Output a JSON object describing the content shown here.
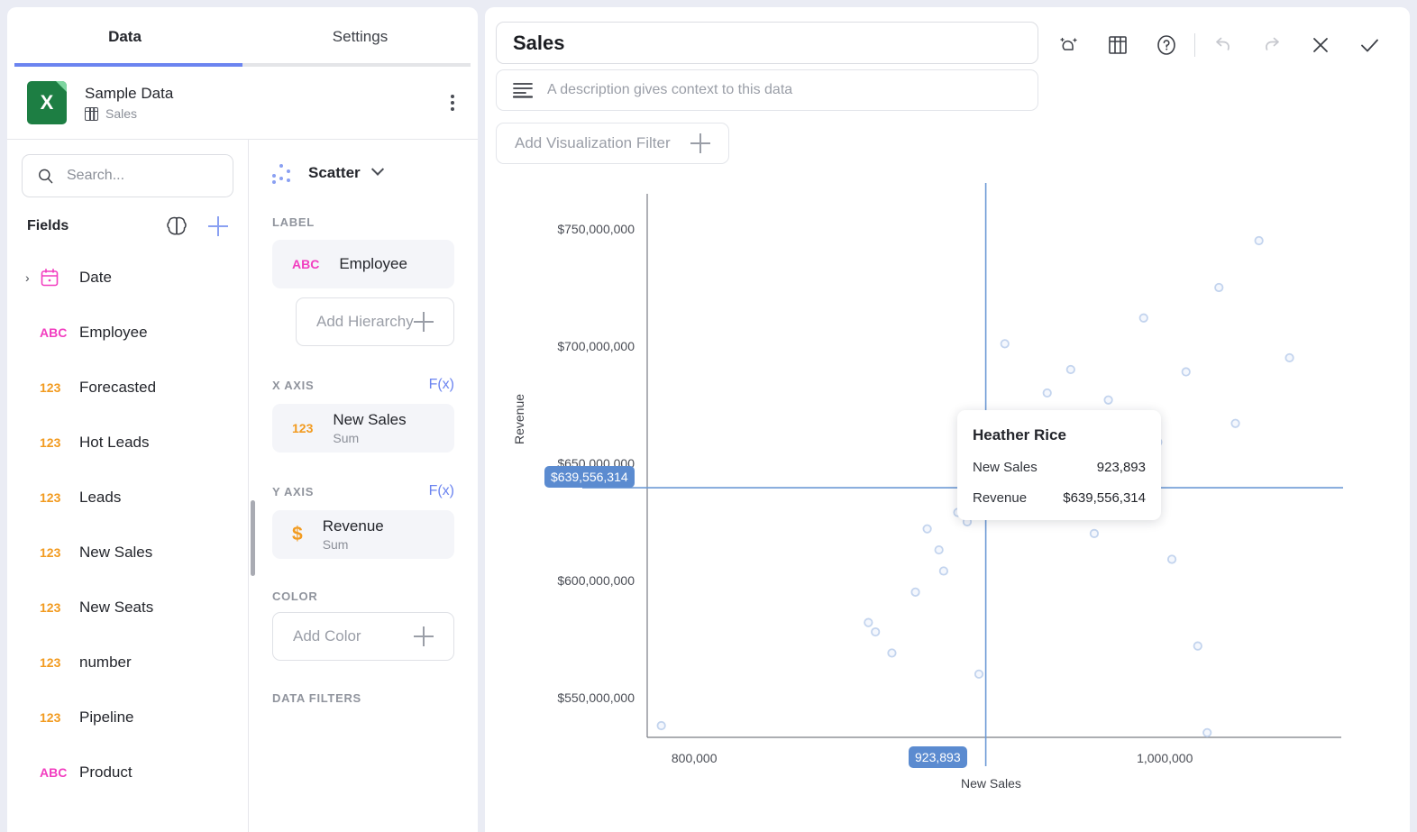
{
  "left_panel": {
    "tabs": [
      {
        "label": "Data",
        "active": true
      },
      {
        "label": "Settings",
        "active": false
      }
    ],
    "source": {
      "icon": "excel-file-icon",
      "title": "Sample Data",
      "table_icon": "table-icon",
      "table_name": "Sales",
      "menu_icon": "kebab-menu-icon"
    },
    "search": {
      "placeholder": "Search...",
      "icon": "search-icon"
    },
    "fields_header": {
      "label": "Fields",
      "ai_icon": "brain-icon",
      "add_icon": "plus-icon"
    },
    "fields": [
      {
        "name": "Date",
        "type": "date",
        "type_label": "",
        "expandable": true
      },
      {
        "name": "Employee",
        "type": "text",
        "type_label": "ABC",
        "expandable": false
      },
      {
        "name": "Forecasted",
        "type": "number",
        "type_label": "123",
        "expandable": false
      },
      {
        "name": "Hot Leads",
        "type": "number",
        "type_label": "123",
        "expandable": false
      },
      {
        "name": "Leads",
        "type": "number",
        "type_label": "123",
        "expandable": false
      },
      {
        "name": "New Sales",
        "type": "number",
        "type_label": "123",
        "expandable": false
      },
      {
        "name": "New Seats",
        "type": "number",
        "type_label": "123",
        "expandable": false
      },
      {
        "name": "number",
        "type": "number",
        "type_label": "123",
        "expandable": false
      },
      {
        "name": "Pipeline",
        "type": "number",
        "type_label": "123",
        "expandable": false
      },
      {
        "name": "Product",
        "type": "text",
        "type_label": "ABC",
        "expandable": false
      }
    ],
    "config": {
      "viz_type": {
        "label": "Scatter",
        "icon": "scatter-icon",
        "caret": "chevron-down-icon"
      },
      "label_section": {
        "heading": "LABEL",
        "field": {
          "name": "Employee",
          "type_label": "ABC"
        },
        "add_hierarchy": "Add Hierarchy"
      },
      "x_axis": {
        "heading": "X AXIS",
        "fx": "F(x)",
        "field": {
          "name": "New Sales",
          "agg": "Sum",
          "type_label": "123"
        }
      },
      "y_axis": {
        "heading": "Y AXIS",
        "fx": "F(x)",
        "field": {
          "name": "Revenue",
          "agg": "Sum",
          "type_label": "$"
        }
      },
      "color": {
        "heading": "COLOR",
        "add_label": "Add Color"
      },
      "data_filters": {
        "heading": "DATA FILTERS"
      }
    }
  },
  "right_panel": {
    "title": "Sales",
    "description_placeholder": "A description gives context to this data",
    "description_icon": "description-lines-icon",
    "filter_button": {
      "label": "Add Visualization Filter",
      "icon": "plus-icon"
    },
    "toolbar": [
      {
        "name": "ai-sparkle-icon",
        "label": ""
      },
      {
        "name": "table-view-icon",
        "label": ""
      },
      {
        "name": "help-circle-icon",
        "label": ""
      },
      {
        "name": "undo-icon",
        "label": "",
        "disabled": true
      },
      {
        "name": "redo-icon",
        "label": "",
        "disabled": true
      },
      {
        "name": "close-icon",
        "label": ""
      },
      {
        "name": "confirm-check-icon",
        "label": ""
      }
    ],
    "tooltip": {
      "title": "Heather Rice",
      "rows": [
        {
          "key": "New Sales",
          "value": "923,893"
        },
        {
          "key": "Revenue",
          "value": "$639,556,314"
        }
      ]
    },
    "crosshair": {
      "y_badge": "$639,556,314",
      "x_badge": "923,893"
    }
  },
  "chart_data": {
    "type": "scatter",
    "title": "Sales",
    "xlabel": "New Sales",
    "ylabel": "Revenue",
    "xticks": [
      "800,000",
      "923,893",
      "1,000,000"
    ],
    "xtick_values": [
      800000,
      923893,
      1000000
    ],
    "yticks": [
      "$550,000,000",
      "$600,000,000",
      "$650,000,000",
      "$700,000,000",
      "$750,000,000"
    ],
    "ytick_values": [
      550000000,
      600000000,
      650000000,
      700000000,
      750000000
    ],
    "xlim": [
      780000,
      1075000
    ],
    "ylim": [
      533000000,
      765000000
    ],
    "grid": false,
    "legend": null,
    "highlight": {
      "label": "Heather Rice",
      "x": 923893,
      "y": 639556314
    },
    "points": [
      {
        "x": 786000,
        "y": 538000000
      },
      {
        "x": 874000,
        "y": 582000000
      },
      {
        "x": 877000,
        "y": 578000000
      },
      {
        "x": 884000,
        "y": 569000000
      },
      {
        "x": 894000,
        "y": 595000000
      },
      {
        "x": 899000,
        "y": 622000000
      },
      {
        "x": 904000,
        "y": 613000000
      },
      {
        "x": 906000,
        "y": 604000000
      },
      {
        "x": 912000,
        "y": 629000000
      },
      {
        "x": 916000,
        "y": 625000000
      },
      {
        "x": 921000,
        "y": 560000000
      },
      {
        "x": 923893,
        "y": 639556314
      },
      {
        "x": 925000,
        "y": 636000000
      },
      {
        "x": 932000,
        "y": 701000000
      },
      {
        "x": 939000,
        "y": 646000000
      },
      {
        "x": 947000,
        "y": 636000000
      },
      {
        "x": 950000,
        "y": 680000000
      },
      {
        "x": 954000,
        "y": 662000000
      },
      {
        "x": 957000,
        "y": 670000000
      },
      {
        "x": 960000,
        "y": 690000000
      },
      {
        "x": 963000,
        "y": 636000000
      },
      {
        "x": 966000,
        "y": 636000000
      },
      {
        "x": 970000,
        "y": 620000000
      },
      {
        "x": 976000,
        "y": 677000000
      },
      {
        "x": 981000,
        "y": 656000000
      },
      {
        "x": 985000,
        "y": 642000000
      },
      {
        "x": 991000,
        "y": 712000000
      },
      {
        "x": 997000,
        "y": 659000000
      },
      {
        "x": 1003000,
        "y": 609000000
      },
      {
        "x": 1009000,
        "y": 689000000
      },
      {
        "x": 1014000,
        "y": 572000000
      },
      {
        "x": 1018000,
        "y": 535000000
      },
      {
        "x": 1023000,
        "y": 725000000
      },
      {
        "x": 1030000,
        "y": 667000000
      },
      {
        "x": 1040000,
        "y": 745000000
      },
      {
        "x": 1053000,
        "y": 695000000
      }
    ]
  }
}
